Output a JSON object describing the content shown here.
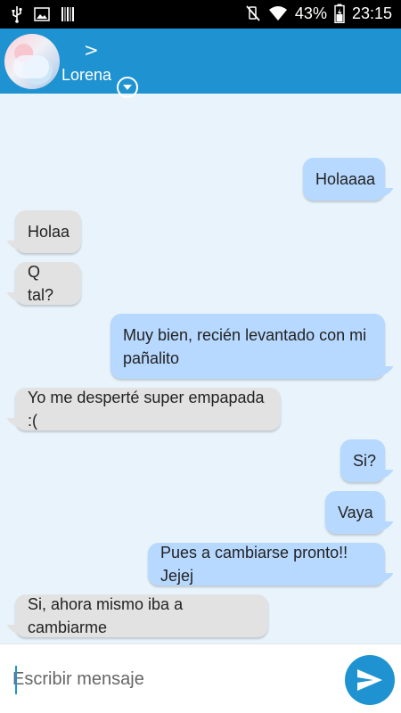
{
  "status_bar": {
    "battery_percent": "43%",
    "time": "23:15",
    "icons": [
      "usb-icon",
      "image-icon",
      "barcode-icon",
      "mute-icon",
      "wifi-icon",
      "battery-icon"
    ]
  },
  "header": {
    "contact_name": "Lorena",
    "chevron": ">",
    "accent_color": "#1f93d1"
  },
  "messages": [
    {
      "direction": "out",
      "text": "Holaaaa"
    },
    {
      "direction": "in",
      "text": "Holaa"
    },
    {
      "direction": "in",
      "text": "Q tal?"
    },
    {
      "direction": "out",
      "text": "Muy bien, recién levantado con mi pañalito"
    },
    {
      "direction": "in",
      "text": "Yo me desperté super empapada :("
    },
    {
      "direction": "out",
      "text": "Si?"
    },
    {
      "direction": "out",
      "text": "Vaya"
    },
    {
      "direction": "out",
      "text": "Pues a cambiarse pronto!! Jejej"
    },
    {
      "direction": "in",
      "text": "Si, ahora mismo iba a cambiarme"
    }
  ],
  "composer": {
    "placeholder": "Escribir mensaje"
  },
  "colors": {
    "incoming_bubble": "#e2e2e2",
    "outgoing_bubble": "#b7d9ff",
    "background": "#e8f3fb"
  }
}
